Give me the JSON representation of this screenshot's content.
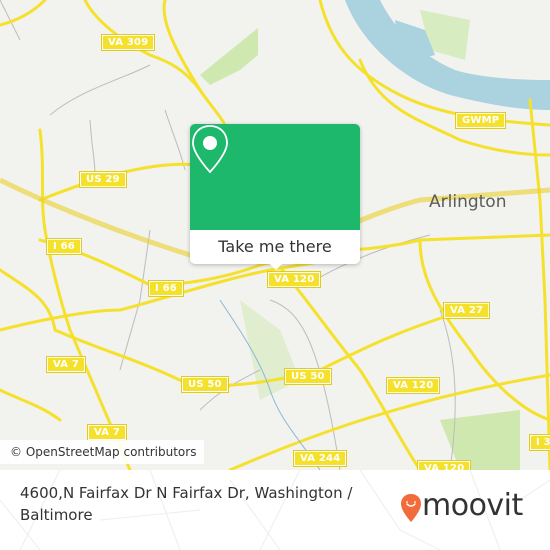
{
  "map": {
    "city_label": "Arlington",
    "road_shields": [
      {
        "label": "VA 309"
      },
      {
        "label": "US 29"
      },
      {
        "label": "I 66"
      },
      {
        "label": "I 66"
      },
      {
        "label": "VA 120"
      },
      {
        "label": "VA 7"
      },
      {
        "label": "VA 7"
      },
      {
        "label": "US 50"
      },
      {
        "label": "US 50"
      },
      {
        "label": "VA 27"
      },
      {
        "label": "VA 120"
      },
      {
        "label": "VA 244"
      },
      {
        "label": "VA 120"
      },
      {
        "label": "GWMP"
      },
      {
        "label": "I 3"
      }
    ],
    "colors": {
      "land": "#f2f2ef",
      "water": "#aad3df",
      "park": "#cfe8b0",
      "road_major": "#f5e12c",
      "road_minor": "#b8b8b8"
    }
  },
  "popup": {
    "cta_label": "Take me there",
    "accent_color": "#1db86c",
    "icon": "map-pin-icon"
  },
  "attribution": "© OpenStreetMap contributors",
  "footer": {
    "address": "4600,N Fairfax Dr N Fairfax Dr, Washington / Baltimore",
    "brand": "moovit",
    "brand_color": "#f26b3a"
  }
}
